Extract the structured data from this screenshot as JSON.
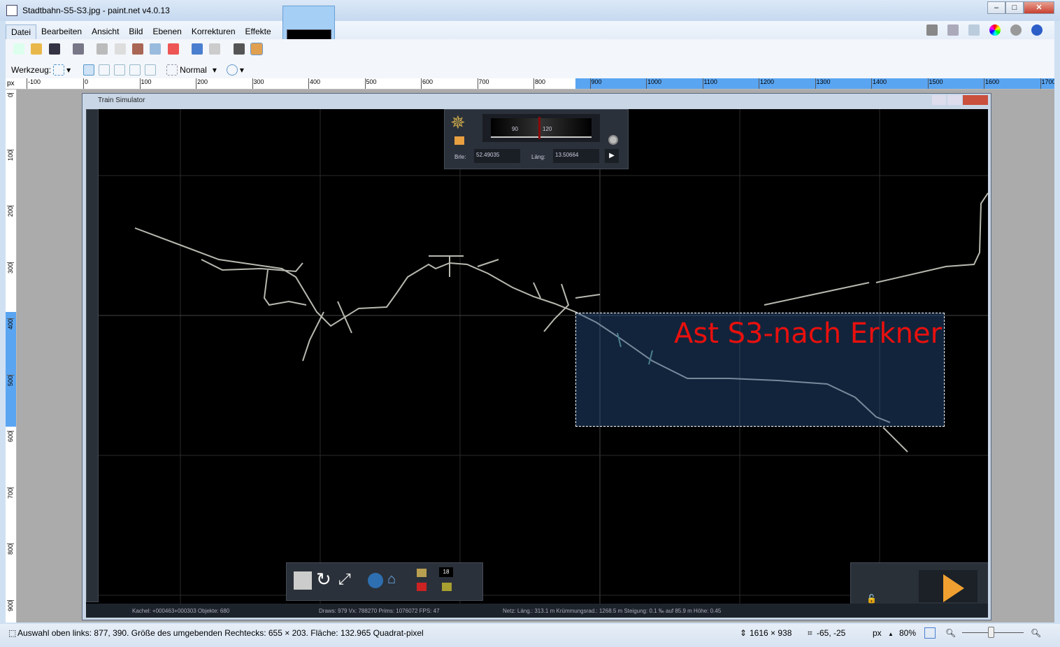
{
  "window": {
    "title": "Stadtbahn-S5-S3.jpg - paint.net v4.0.13",
    "min": "–",
    "max": "□",
    "close": "✕"
  },
  "menu": [
    "Datei",
    "Bearbeiten",
    "Ansicht",
    "Bild",
    "Ebenen",
    "Korrekturen",
    "Effekte"
  ],
  "toolbar": {
    "tool_label": "Werkzeug:",
    "blend_mode": "Normal"
  },
  "ruler": {
    "unit": "px",
    "h_ticks": [
      "-100",
      "0",
      "100",
      "200",
      "300",
      "400",
      "500",
      "600",
      "700",
      "800",
      "900",
      "1000",
      "1100",
      "1200",
      "1300",
      "1400",
      "1500",
      "1600",
      "1700"
    ],
    "v_ticks": [
      "0",
      "100",
      "200",
      "300",
      "400",
      "500",
      "600",
      "700",
      "800",
      "900"
    ]
  },
  "sim": {
    "title": "Train Simulator",
    "compass": {
      "heading_marks": [
        "90",
        "120"
      ],
      "lat_label": "Brle:",
      "lat": "52.49035",
      "lon_label": "Läng:",
      "lon": "13.50664"
    },
    "clock_value": "18",
    "status": {
      "tile": "Kachel: +000463+000303  Objekte: 680",
      "render": "Draws: 979 Vx: 788270 Prims: 1076072 FPS: 47",
      "net": "Netz:  Läng.:  313.1 m Krümmungsrad.: 1268.5 m Steigung:  0.1 ‰ auf 85.9 m Höhe:   0.45"
    }
  },
  "annotation": "Ast S3-nach Erkner",
  "statusbar": {
    "selection": "Auswahl oben links: 877, 390. Größe des umgebenden Rechtecks: 655 × 203. Fläche: 132.965 Quadrat-pixel",
    "image_size": "1616 × 938",
    "cursor": "-65, -25",
    "unit": "px",
    "zoom": "80%"
  },
  "zoom_level_percent": 80
}
